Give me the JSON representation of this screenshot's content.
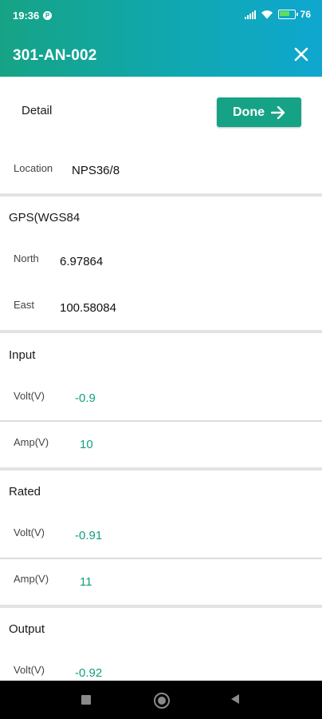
{
  "status_bar": {
    "time": "19:36",
    "battery": "76"
  },
  "app_bar": {
    "title": "301-AN-002"
  },
  "detail": {
    "heading": "Detail",
    "done_label": "Done",
    "location_label": "Location",
    "location_value": "NPS36/8"
  },
  "gps": {
    "title": "GPS(WGS84",
    "north_label": "North",
    "north_value": "6.97864",
    "east_label": "East",
    "east_value": "100.58084"
  },
  "input": {
    "title": "Input",
    "volt_label": "Volt(V)",
    "volt_value": "-0.9",
    "amp_label": "Amp(V)",
    "amp_value": "10"
  },
  "rated": {
    "title": "Rated",
    "volt_label": "Volt(V)",
    "volt_value": "-0.91",
    "amp_label": "Amp(V)",
    "amp_value": "11"
  },
  "output": {
    "title": "Output",
    "volt_label": "Volt(V)",
    "volt_value": "-0.92"
  },
  "colors": {
    "accent": "#16a385",
    "value_green": "#109f7e"
  }
}
